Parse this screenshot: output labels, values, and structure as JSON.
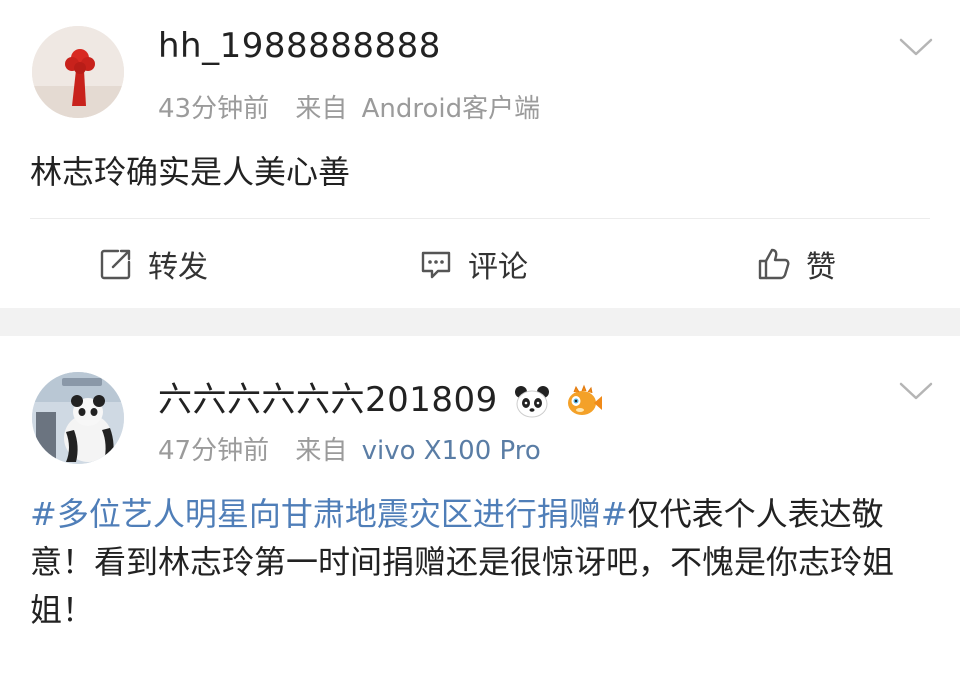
{
  "posts": [
    {
      "username": "hh_1988888888",
      "time": "43分钟前",
      "source_prefix": "来自",
      "source": "Android客户端",
      "content": "林志玲确实是人美心善",
      "actions": {
        "repost": "转发",
        "comment": "评论",
        "like": "赞"
      }
    },
    {
      "username": "六六六六六六201809",
      "badges": [
        "panda-emoji",
        "pufferfish-emoji"
      ],
      "time": "47分钟前",
      "source_prefix": "来自",
      "source": "vivo X100 Pro",
      "topic": "#多位艺人明星向甘肃地震灾区进行捐赠#",
      "content": "仅代表个人表达敬意！看到林志玲第一时间捐赠还是很惊讶吧，不愧是你志玲姐姐！"
    }
  ],
  "colors": {
    "topic": "#4f7eb8",
    "meta": "#9b9b9b",
    "source_link": "#5a7da5",
    "separator": "#f2f2f2"
  },
  "icons": [
    "chevron-down-icon",
    "repost-icon",
    "comment-icon",
    "like-icon"
  ]
}
